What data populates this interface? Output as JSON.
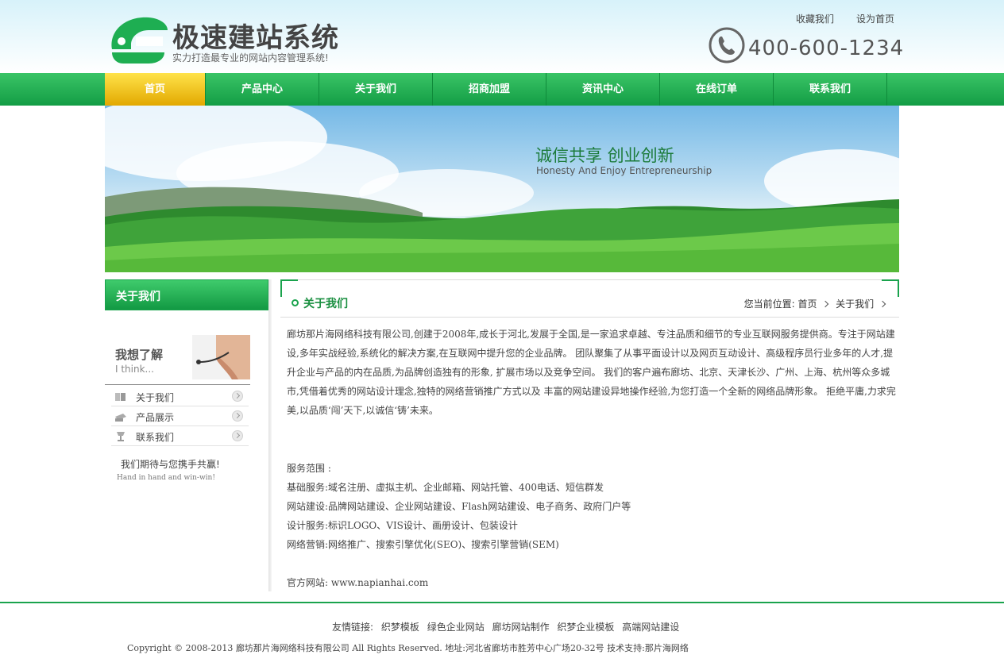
{
  "header": {
    "logo_title": "极速建站系统",
    "logo_slogan": "实力打造最专业的网站内容管理系统!",
    "top_links": [
      "收藏我们",
      "设为首页"
    ],
    "phone": "400-600-1234"
  },
  "nav": {
    "items": [
      "首页",
      "产品中心",
      "关于我们",
      "招商加盟",
      "资讯中心",
      "在线订单",
      "联系我们"
    ],
    "active_index": 0
  },
  "banner": {
    "title": "诚信共享  创业创新",
    "subtitle": "Honesty And Enjoy  Entrepreneurship"
  },
  "sidebar": {
    "heading": "关于我们",
    "think_cn": "我想了解",
    "think_en": "I think...",
    "items": [
      "关于我们",
      "产品展示",
      "联系我们"
    ],
    "hope_cn": "我们期待与您携手共赢!",
    "hope_en": "Hand in hand and win-win!"
  },
  "content": {
    "title": "关于我们",
    "breadcrumb_label": "您当前位置:",
    "breadcrumb": [
      "首页",
      "关于我们"
    ],
    "intro": "廊坊那片海网络科技有限公司,创建于2008年,成长于河北,发展于全国,是一家追求卓越、专注品质和细节的专业互联网服务提供商。专注于网站建设,多年实战经验,系统化的解决方案,在互联网中提升您的企业品牌。 团队聚集了从事平面设计以及网页互动设计、高级程序员行业多年的人才,提升企业与产品的内在品质,为品牌创造独有的形象, 扩展市场以及竞争空间。 我们的客户遍布廊坊、北京、天津长沙、广州、上海、杭州等众多城市,凭借着优秀的网站设计理念,独特的网络营销推广方式以及 丰富的网站建设异地操作经验,为您打造一个全新的网络品牌形象。 拒绝平庸,力求完美,以品质‘闯’天下,以诚信‘铸’未来。",
    "service_heading": "服务范围 :",
    "services": [
      "基础服务:域名注册、虚拟主机、企业邮箱、网站托管、400电话、短信群发",
      "网站建设:品牌网站建设、企业网站建设、Flash网站建设、电子商务、政府门户等",
      "设计服务:标识LOGO、VIS设计、画册设计、包装设计",
      "网络营销:网络推广、搜索引擎优化(SEO)、搜索引擎营销(SEM)"
    ],
    "website": "官方网站: www.napianhai.com"
  },
  "footer": {
    "friend_label": "友情链接:",
    "friend_links": [
      "织梦模板",
      "绿色企业网站",
      "廊坊网站制作",
      "织梦企业模板",
      "高端网站建设"
    ],
    "copyright": "Copyright © 2008-2013 廊坊那片海网络科技有限公司 All Rights Reserved. 地址:河北省廊坊市胜芳中心广场20-32号 技术支持:那片海网络"
  },
  "colors": {
    "brand_green": "#1aa34d",
    "nav_active": "#f2c200",
    "text": "#444444"
  }
}
